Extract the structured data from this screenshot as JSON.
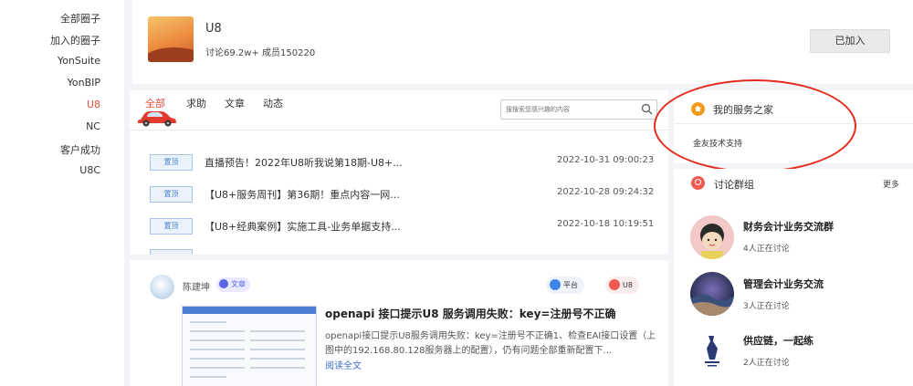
{
  "sidebar": {
    "items": [
      {
        "label": "全部圈子",
        "active": false
      },
      {
        "label": "加入的圈子",
        "active": false
      },
      {
        "label": "YonSuite",
        "active": false
      },
      {
        "label": "YonBIP",
        "active": false
      },
      {
        "label": "U8",
        "active": true
      },
      {
        "label": "NC",
        "active": false
      },
      {
        "label": "客户成功",
        "active": false
      },
      {
        "label": "U8C",
        "active": false
      }
    ]
  },
  "circle": {
    "name": "U8",
    "stats": "讨论69.2w+ 成员150220",
    "joined_label": "已加入"
  },
  "feed": {
    "tabs": [
      "全部",
      "求助",
      "文章",
      "动态"
    ],
    "active_tab": 0,
    "search_placeholder": "搜搜索您感兴趣的内容",
    "rows": [
      {
        "badge": "置顶",
        "title": "直播预告！2022年U8听我说第18期-U8+...",
        "date": "2022-10-31 09:00:23"
      },
      {
        "badge": "置顶",
        "title": "【U8+服务周刊】第36期！重点内容一网...",
        "date": "2022-10-28 09:24:32"
      },
      {
        "badge": "置顶",
        "title": "【U8+经典案例】实施工具-业务单据支持...",
        "date": "2022-10-18 10:19:51"
      }
    ]
  },
  "post": {
    "author": "陈建坤",
    "type": "文章",
    "tags": [
      "平台",
      "U8"
    ],
    "title": "openapi 接口提示U8 服务调用失败：key=注册号不正确",
    "excerpt": "openapi接口提示U8服务调用失败：key=注册号不正确1、检查EAI接口设置（上图中的192.168.80.128服务器上的配置），仍有问题全部重新配置下...",
    "read_more": "阅读全文"
  },
  "service": {
    "title": "我的服务之家",
    "link": "金友技术支持"
  },
  "groups": {
    "title": "讨论群组",
    "more": "更多",
    "items": [
      {
        "name": "财务会计业务交流群",
        "count": "4人正在讨论"
      },
      {
        "name": "管理会计业务交流",
        "count": "3人正在讨论"
      },
      {
        "name": "供应链，一起练",
        "count": "2人正在讨论"
      }
    ]
  },
  "colors": {
    "accent": "#e84c3d",
    "annotation": "#e52a1e",
    "link": "#3b6fc7"
  }
}
